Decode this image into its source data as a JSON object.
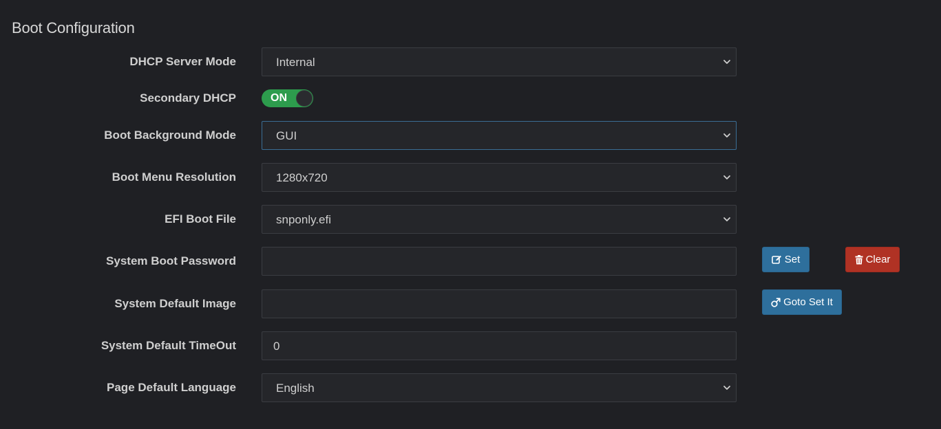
{
  "section": {
    "title": "Boot Configuration"
  },
  "dhcp_server_mode": {
    "label": "DHCP Server Mode",
    "value": "Internal"
  },
  "secondary_dhcp": {
    "label": "Secondary DHCP",
    "state": "ON"
  },
  "boot_background_mode": {
    "label": "Boot Background Mode",
    "value": "GUI"
  },
  "boot_menu_resolution": {
    "label": "Boot Menu Resolution",
    "value": "1280x720"
  },
  "efi_boot_file": {
    "label": "EFI Boot File",
    "value": "snponly.efi"
  },
  "system_boot_password": {
    "label": "System Boot Password",
    "value": "",
    "set_button": "Set",
    "clear_button": "Clear"
  },
  "system_default_image": {
    "label": "System Default Image",
    "value": "",
    "goto_button": "Goto Set It"
  },
  "system_default_timeout": {
    "label": "System Default TimeOut",
    "value": "0"
  },
  "page_default_language": {
    "label": "Page Default Language",
    "value": "English"
  },
  "icons": {
    "select_arrow": "chevron-down-icon",
    "set_button_icon": "edit-icon",
    "clear_button_icon": "trash-icon",
    "goto_button_icon": "male-icon"
  },
  "colors": {
    "background": "#1f2024",
    "field_background": "#25262a",
    "toggle_on": "#2d9c4d",
    "primary_button": "#2e6f9c",
    "danger_button": "#b03224",
    "focus_border": "#3b6e95"
  }
}
